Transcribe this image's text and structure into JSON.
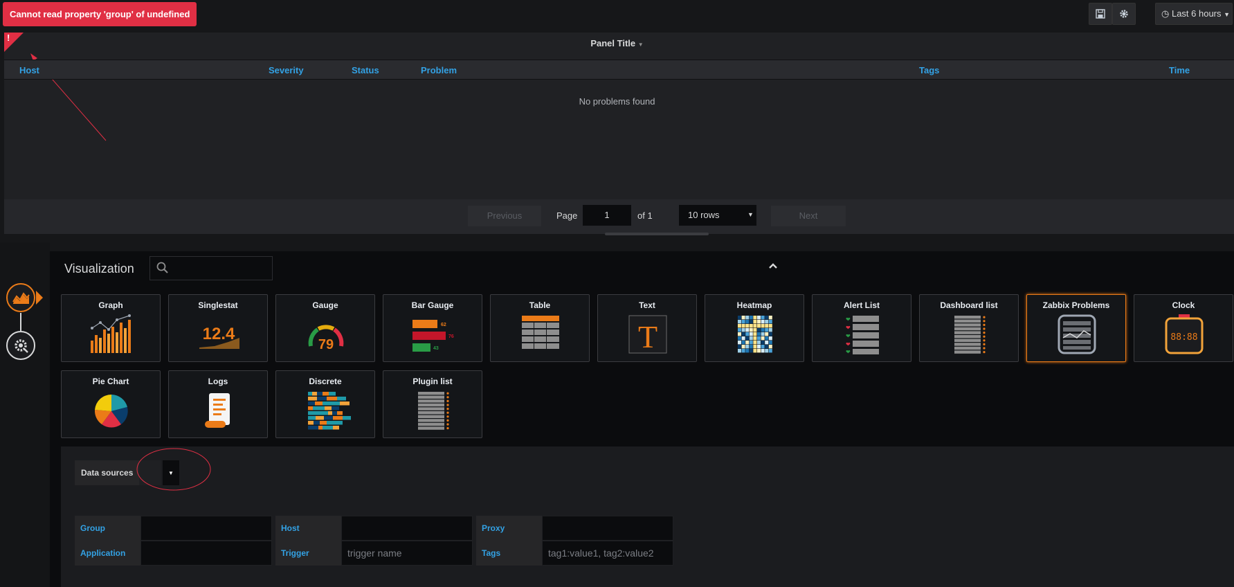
{
  "top": {
    "error_message": "Cannot read property 'group' of undefined",
    "time_range": "Last 6 hours"
  },
  "panel": {
    "title": "Panel Title",
    "columns": [
      "Host",
      "Severity",
      "Status",
      "Problem",
      "Tags",
      "Time"
    ],
    "empty_text": "No problems found",
    "pagination": {
      "previous": "Previous",
      "page_label": "Page",
      "page_value": "1",
      "of_label": "of 1",
      "rows": "10 rows",
      "next": "Next"
    }
  },
  "viz": {
    "title": "Visualization",
    "selected": "Zabbix Problems",
    "row1": [
      "Graph",
      "Singlestat",
      "Gauge",
      "Bar Gauge",
      "Table",
      "Text",
      "Heatmap",
      "Alert List",
      "Dashboard list",
      "Zabbix Problems",
      "Clock"
    ],
    "row2": [
      "Pie Chart",
      "Logs",
      "Discrete",
      "Plugin list"
    ],
    "singlestat_value": "12.4",
    "gauge_value": "79",
    "bargauge_values": [
      "62",
      "76",
      "43"
    ],
    "text_letter": "T",
    "clock_text": "88:88"
  },
  "query": {
    "data_sources_label": "Data sources",
    "group_label": "Group",
    "host_label": "Host",
    "proxy_label": "Proxy",
    "application_label": "Application",
    "trigger_label": "Trigger",
    "tags_label": "Tags",
    "trigger_placeholder": "trigger name",
    "tags_placeholder": "tag1:value1, tag2:value2"
  },
  "colors": {
    "accent": "#eb7b18",
    "error": "#e02f44",
    "link_blue": "#33a2e5"
  }
}
